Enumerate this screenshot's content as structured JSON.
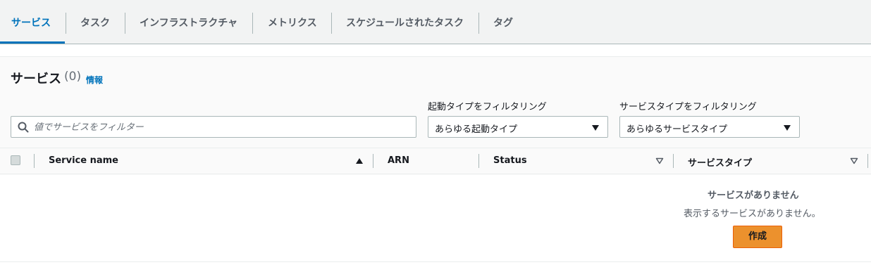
{
  "tabs": [
    {
      "label": "サービス",
      "active": true
    },
    {
      "label": "タスク"
    },
    {
      "label": "インフラストラクチャ"
    },
    {
      "label": "メトリクス"
    },
    {
      "label": "スケジュールされたタスク"
    },
    {
      "label": "タグ"
    }
  ],
  "section": {
    "title": "サービス",
    "count": "(0)",
    "info_link": "情報"
  },
  "search": {
    "placeholder": "値でサービスをフィルター",
    "value": ""
  },
  "filters": {
    "launch_type": {
      "label": "起動タイプをフィルタリング",
      "selected": "あらゆる起動タイプ"
    },
    "service_type": {
      "label": "サービスタイプをフィルタリング",
      "selected": "あらゆるサービスタイプ"
    }
  },
  "table": {
    "columns": [
      "Service name",
      "ARN",
      "Status",
      "サービスタイプ"
    ],
    "sort": {
      "column": "Service name",
      "direction": "ascending"
    }
  },
  "empty_state": {
    "title": "サービスがありません",
    "description": "表示するサービスがありません。",
    "button_label": "作成"
  },
  "colors": {
    "accent": "#0073bb",
    "primary_button": "#ec912d"
  }
}
